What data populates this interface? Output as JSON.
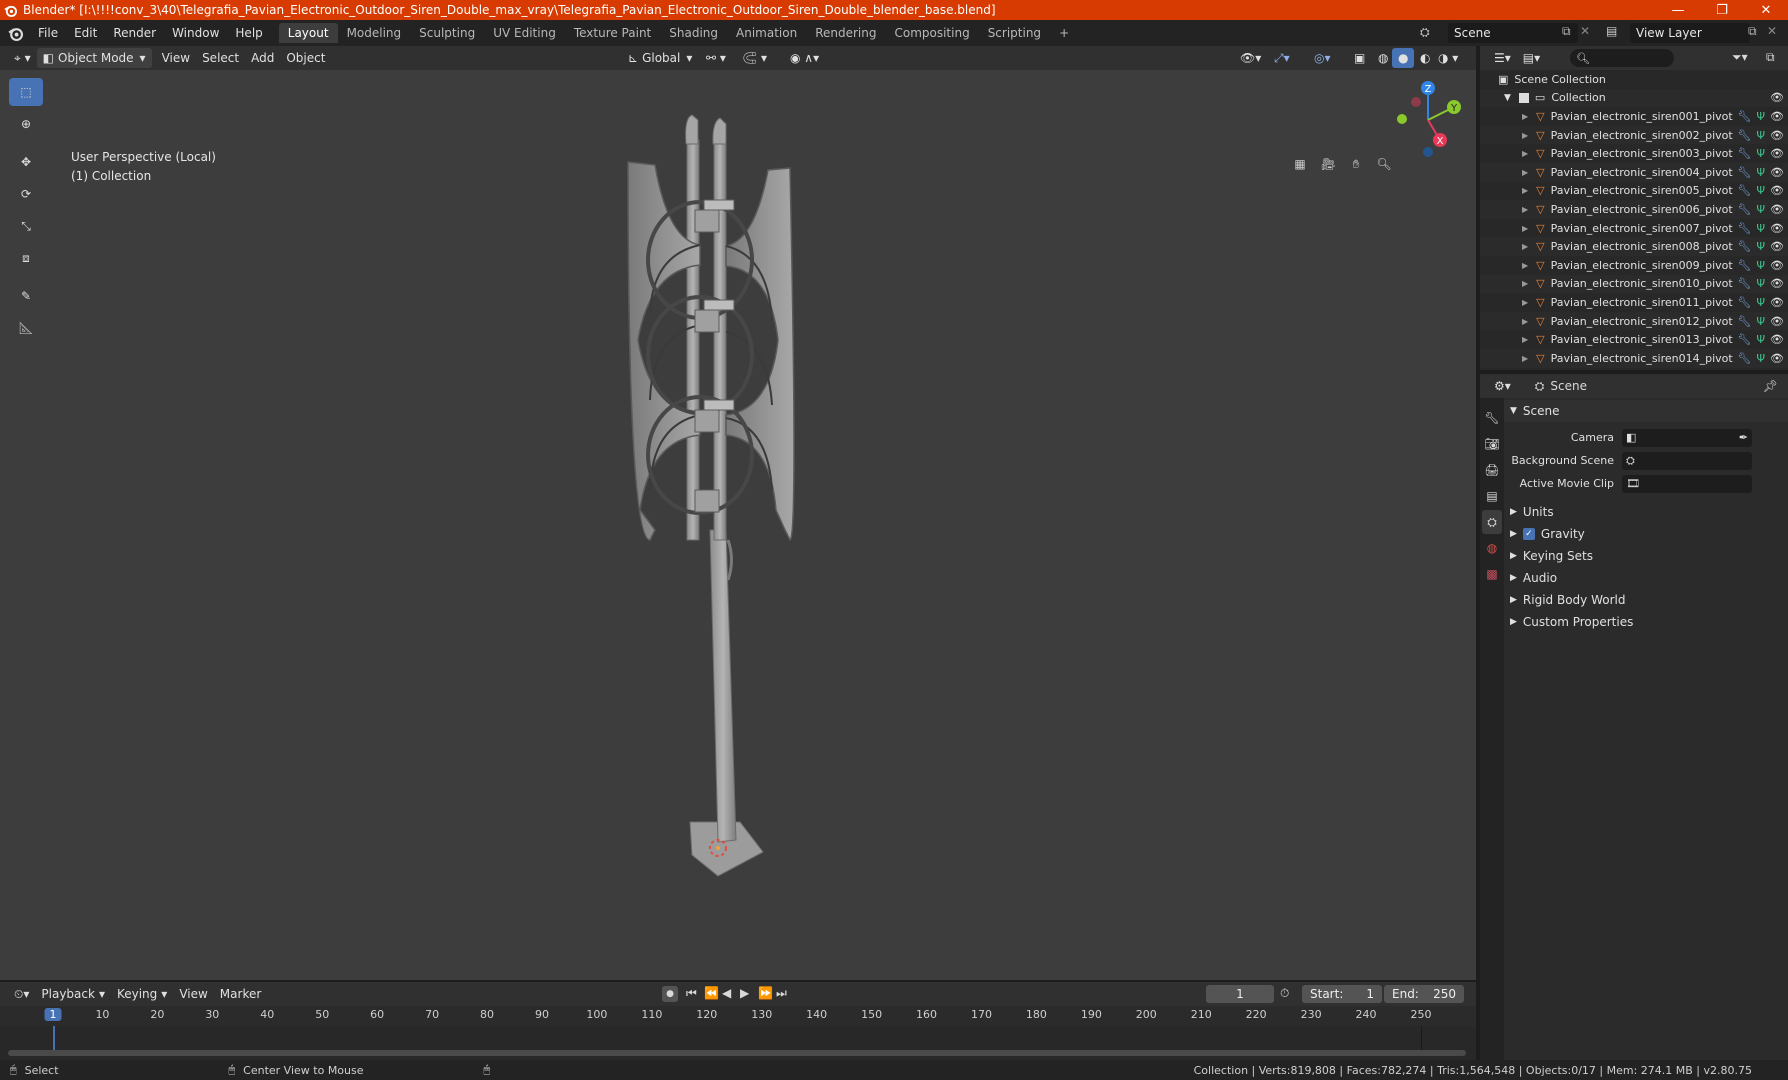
{
  "window": {
    "title": "Blender* [I:\\!!!!conv_3\\40\\Telegrafia_Pavian_Electronic_Outdoor_Siren_Double_max_vray\\Telegrafia_Pavian_Electronic_Outdoor_Siren_Double_blender_base.blend]",
    "minimize": "—",
    "maximize": "❐",
    "close": "✕"
  },
  "menu": [
    "File",
    "Edit",
    "Render",
    "Window",
    "Help"
  ],
  "workspaces": [
    "Layout",
    "Modeling",
    "Sculpting",
    "UV Editing",
    "Texture Paint",
    "Shading",
    "Animation",
    "Rendering",
    "Compositing",
    "Scripting",
    "+"
  ],
  "active_workspace": "Layout",
  "scene_selector": "Scene",
  "view_layer": "View Layer",
  "viewport": {
    "mode": "Object Mode",
    "menus": [
      "View",
      "Select",
      "Add",
      "Object"
    ],
    "transform_orientation": "Global",
    "perspective_label": "User Perspective (Local)",
    "collection_label": "(1) Collection"
  },
  "gizmo": {
    "x": "X",
    "y": "Y",
    "z": "Z"
  },
  "outliner": {
    "root": "Scene Collection",
    "collection": "Collection",
    "items": [
      "Pavian_electronic_siren001_pivot",
      "Pavian_electronic_siren002_pivot",
      "Pavian_electronic_siren003_pivot",
      "Pavian_electronic_siren004_pivot",
      "Pavian_electronic_siren005_pivot",
      "Pavian_electronic_siren006_pivot",
      "Pavian_electronic_siren007_pivot",
      "Pavian_electronic_siren008_pivot",
      "Pavian_electronic_siren009_pivot",
      "Pavian_electronic_siren010_pivot",
      "Pavian_electronic_siren011_pivot",
      "Pavian_electronic_siren012_pivot",
      "Pavian_electronic_siren013_pivot",
      "Pavian_electronic_siren014_pivot"
    ]
  },
  "properties": {
    "context": "Scene",
    "section": "Scene",
    "fields": [
      {
        "label": "Camera"
      },
      {
        "label": "Background Scene"
      },
      {
        "label": "Active Movie Clip"
      }
    ],
    "panels": [
      "Units",
      "Gravity",
      "Keying Sets",
      "Audio",
      "Rigid Body World",
      "Custom Properties"
    ]
  },
  "timeline": {
    "menus": [
      "Playback",
      "Keying",
      "View",
      "Marker"
    ],
    "current_frame": "1",
    "start_label": "Start:",
    "start": "1",
    "end_label": "End:",
    "end": "250",
    "ruler": [
      "1",
      "10",
      "20",
      "30",
      "40",
      "50",
      "60",
      "70",
      "80",
      "90",
      "100",
      "110",
      "120",
      "130",
      "140",
      "150",
      "160",
      "170",
      "180",
      "190",
      "200",
      "210",
      "220",
      "230",
      "240",
      "250"
    ]
  },
  "statusbar": {
    "select": "Select",
    "center_view": "Center View to Mouse",
    "stats": "Collection | Verts:819,808 | Faces:782,274 | Tris:1,564,548 | Objects:0/17 | Mem: 274.1 MB | v2.80.75"
  },
  "colors": {
    "titlebar": "#d83b01",
    "accent": "#4772b3",
    "mesh_icon": "#e8833a",
    "axis_x": "#e8395a",
    "axis_y": "#8ac92b",
    "axis_z": "#2f86e8"
  }
}
